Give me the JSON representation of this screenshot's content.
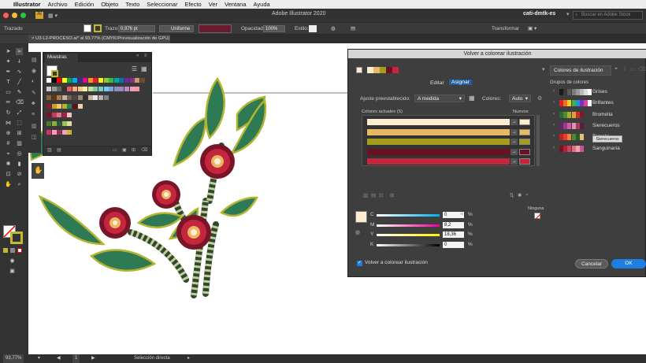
{
  "menubar": {
    "app": "Illustrator",
    "items": [
      "Archivo",
      "Edición",
      "Objeto",
      "Texto",
      "Seleccionar",
      "Efecto",
      "Ver",
      "Ventana",
      "Ayuda"
    ]
  },
  "titlebar": {
    "title": "Adobe Illustrator 2020",
    "workspace": "cati-dmtk-es",
    "search_placeholder": "Buscar en Adobe Stock"
  },
  "control": {
    "mode": "Trazado",
    "stroke_label": "Trazo:",
    "stroke_value": "0,976 pt",
    "profile": "Uniforme",
    "opacity_label": "Opacidad:",
    "opacity_value": "100%",
    "style_label": "Estilo:",
    "transform_label": "Transformar"
  },
  "doc_tab": "U3-L2-PROCESO.ai* al 93,77% (CMYK/Previsualización de GPU)",
  "status": {
    "zoom": "93,77%",
    "page": "1",
    "tool": "Selección directa"
  },
  "swatches": {
    "title": "Muestras",
    "row1": [
      "#ffffff",
      "#000000",
      "#ff0000",
      "#ffff00",
      "#00a651",
      "#00aeef",
      "#2e3192",
      "#ec008c",
      "#f7941d",
      "#ed1c24",
      "#fff200",
      "#8dc63f",
      "#39b54a",
      "#00a99d",
      "#0072bc",
      "#662d91",
      "#92278f",
      "#c69c6d",
      "#754c24"
    ],
    "row2": [
      "#cccccc",
      "#999999",
      "#666666",
      "#333333",
      "#ef5b5b",
      "#f9ad81",
      "#fdc689",
      "#fff799",
      "#c4df9b",
      "#82ca9c",
      "#7accc8",
      "#6dcff6",
      "#7da7d9",
      "#8393ca",
      "#a186be",
      "#bd8cbf",
      "#f49ac1",
      "#f6989d"
    ],
    "row3": [
      "#8c6239",
      "#603913",
      "#a67c52",
      "#c7b299",
      "#736357",
      "#534741",
      "#998675",
      "#362f2d",
      "#c2b59b",
      "#e6e6e6",
      "#b3b3b3",
      "#808080"
    ],
    "row4": [
      "#8a1c2b",
      "#c8a030",
      "#f2c46d",
      "#b4b432",
      "#2d7a55",
      "#5d0f1d",
      "#e8d5a0"
    ],
    "row5": [
      "#7a1428",
      "#c63a5a",
      "#e07090",
      "#a82040",
      "#f4c0c8"
    ],
    "row6": [
      "#4e7a2a",
      "#88b040",
      "#2a5a3a",
      "#a0c060",
      "#d8e0a0"
    ],
    "row7": [
      "#cc3366",
      "#ff99bb",
      "#993355",
      "#f2a1c0",
      "#d4af37"
    ]
  },
  "dialog": {
    "title": "Volver a colorear ilustración",
    "right_tab": "Colores de ilustración",
    "tab_edit": "Editar",
    "tab_assign": "Asignar",
    "preset_label": "Ajuste preestablecido:",
    "preset_value": "A medida",
    "colors_label": "Colores:",
    "colors_value": "Auto",
    "current_colors_label": "Colores actuales (5)",
    "new_label": "Nuevos",
    "current_colors": [
      "#fcecd0",
      "#e8b865",
      "#a49c1c",
      "#6b1122",
      "#c4263e"
    ],
    "new_colors": [
      "#fcecd0",
      "#e8b865",
      "#a49c1c",
      "#6b1122",
      "#c4263e"
    ],
    "groups_label": "Grupos de colores",
    "groups": [
      {
        "name": "Grises",
        "colors": [
          "#1a1a1a",
          "#3a3a3a",
          "#5a5a5a",
          "#7a7a7a",
          "#9a9a9a",
          "#bbbbbb",
          "#dddddd",
          "#ffffff"
        ]
      },
      {
        "name": "Brillantes",
        "colors": [
          "#e02020",
          "#f07020",
          "#f0d020",
          "#40b040",
          "#2090e0",
          "#8030c0",
          "#e040a0",
          "#ffffff"
        ]
      },
      {
        "name": "Bromelia",
        "colors": [
          "#2d6a3a",
          "#4e8a30",
          "#a0b030",
          "#e0a030",
          "#c03030",
          "#7a1a2a"
        ]
      },
      {
        "name": "Sierecueros",
        "colors": [
          "#5a2a6a",
          "#a03a8a",
          "#d05aa0",
          "#e090b0",
          "#a04060",
          "#601a3a"
        ]
      },
      {
        "name": "Tomate",
        "colors": [
          "#c02020",
          "#e04030",
          "#f08040",
          "#4a8a30",
          "#2a5a20",
          "#e0c080"
        ]
      },
      {
        "name": "Sanguinaria",
        "colors": [
          "#7a1020",
          "#b02040",
          "#d04060",
          "#e07080",
          "#f0a0b0",
          "#c05a8a"
        ]
      }
    ],
    "tooltip": "Sierecueros",
    "cmyk": [
      {
        "label": "C",
        "value": "0"
      },
      {
        "label": "M",
        "value": "8,2"
      },
      {
        "label": "Y",
        "value": "18,36"
      },
      {
        "label": "K",
        "value": "0"
      }
    ],
    "pct": "%",
    "ninguna": "Ninguna",
    "recolor_checkbox": "Volver a colorear ilustración",
    "cancel": "Cancelar",
    "ok": "OK",
    "current_swatch": "#fcecd0"
  }
}
